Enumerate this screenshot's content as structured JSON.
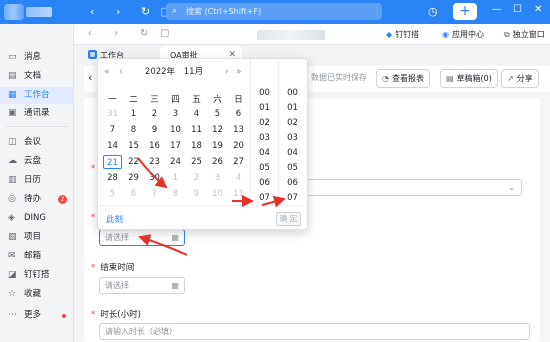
{
  "topbar": {
    "search_placeholder": "搜索 (Ctrl+Shift+F)",
    "history_icon": "history-icon",
    "add_label": "+",
    "window_controls": [
      "—",
      "☐",
      "✕"
    ]
  },
  "sidebar": {
    "items": [
      {
        "label": "消息",
        "icon": "message-icon"
      },
      {
        "label": "文档",
        "icon": "document-icon"
      },
      {
        "label": "工作台",
        "icon": "workbench-icon",
        "active": true
      },
      {
        "label": "通讯录",
        "icon": "contacts-icon"
      },
      {
        "label": "会议",
        "icon": "meeting-icon"
      },
      {
        "label": "云盘",
        "icon": "cloud-icon"
      },
      {
        "label": "日历",
        "icon": "calendar-icon"
      },
      {
        "label": "待办",
        "icon": "todo-icon",
        "badge": "2"
      },
      {
        "label": "DING",
        "icon": "ding-icon"
      },
      {
        "label": "项目",
        "icon": "project-icon"
      },
      {
        "label": "邮箱",
        "icon": "mail-icon"
      },
      {
        "label": "钉钉搭",
        "icon": "builder-icon"
      },
      {
        "label": "收藏",
        "icon": "favorite-icon"
      },
      {
        "label": "更多",
        "icon": "more-icon",
        "dot": true
      }
    ]
  },
  "toolbar": {
    "right_items": [
      "钉钉搭",
      "应用中心",
      "独立窗口"
    ]
  },
  "tabs": [
    {
      "label": "工作台"
    },
    {
      "label": "OA审批",
      "active": true
    }
  ],
  "form_header": {
    "draft_note": "数据已实时保存",
    "buttons": [
      "查看报表",
      "草稿箱(0)",
      "分享"
    ]
  },
  "form": {
    "start_placeholder": "请选择",
    "end_label": "结束时间",
    "end_placeholder": "请选择",
    "duration_label": "时长(小时)",
    "duration_placeholder": "请输入时长（必填）"
  },
  "datepicker": {
    "year": "2022年",
    "month": "11月",
    "weekdays": [
      "一",
      "二",
      "三",
      "四",
      "五",
      "六",
      "日"
    ],
    "weeks": [
      [
        "31",
        "1",
        "2",
        "3",
        "4",
        "5",
        "6"
      ],
      [
        "7",
        "8",
        "9",
        "10",
        "11",
        "12",
        "13"
      ],
      [
        "14",
        "15",
        "16",
        "17",
        "18",
        "19",
        "20"
      ],
      [
        "21",
        "22",
        "23",
        "24",
        "25",
        "26",
        "27"
      ],
      [
        "28",
        "29",
        "30",
        "1",
        "2",
        "3",
        "4"
      ],
      [
        "5",
        "6",
        "7",
        "8",
        "9",
        "10",
        "11"
      ]
    ],
    "today": "21",
    "hours": [
      "00",
      "01",
      "02",
      "03",
      "04",
      "05",
      "06",
      "07"
    ],
    "minutes": [
      "00",
      "01",
      "02",
      "03",
      "04",
      "05",
      "06",
      "07"
    ],
    "now_label": "此刻",
    "ok_label": "确 定"
  },
  "colors": {
    "accent": "#2a84f6",
    "annotation_arrow": "#e5322d"
  }
}
